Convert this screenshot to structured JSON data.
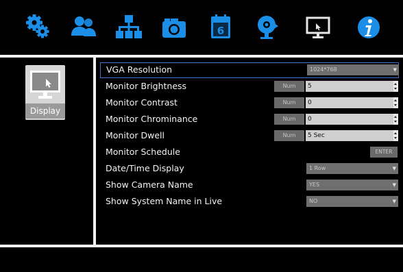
{
  "toolbar": {
    "icons": [
      {
        "name": "system-settings-icon"
      },
      {
        "name": "users-icon"
      },
      {
        "name": "network-icon"
      },
      {
        "name": "camera-icon"
      },
      {
        "name": "schedule-icon",
        "day": "6"
      },
      {
        "name": "alarm-icon"
      },
      {
        "name": "display-icon"
      },
      {
        "name": "info-icon"
      }
    ],
    "icon_color": "#1b8ee8"
  },
  "sidebar": {
    "selected": {
      "label": "Display",
      "icon": "monitor-icon"
    }
  },
  "settings": {
    "vga_resolution": {
      "label": "VGA Resolution",
      "value": "1024*768"
    },
    "brightness": {
      "label": "Monitor Brightness",
      "button": "Num",
      "value": "5"
    },
    "contrast": {
      "label": "Monitor Contrast",
      "button": "Num",
      "value": "0"
    },
    "chrominance": {
      "label": "Monitor Chrominance",
      "button": "Num",
      "value": "0"
    },
    "dwell": {
      "label": "Monitor Dwell",
      "button": "Num",
      "value": "5 Sec"
    },
    "schedule": {
      "label": "Monitor Schedule",
      "button": "ENTER"
    },
    "datetime": {
      "label": "Date/Time Display",
      "value": "1 Row"
    },
    "camera_name": {
      "label": "Show Camera Name",
      "value": "YES"
    },
    "system_name": {
      "label": "Show System Name in Live",
      "value": "NO"
    }
  }
}
